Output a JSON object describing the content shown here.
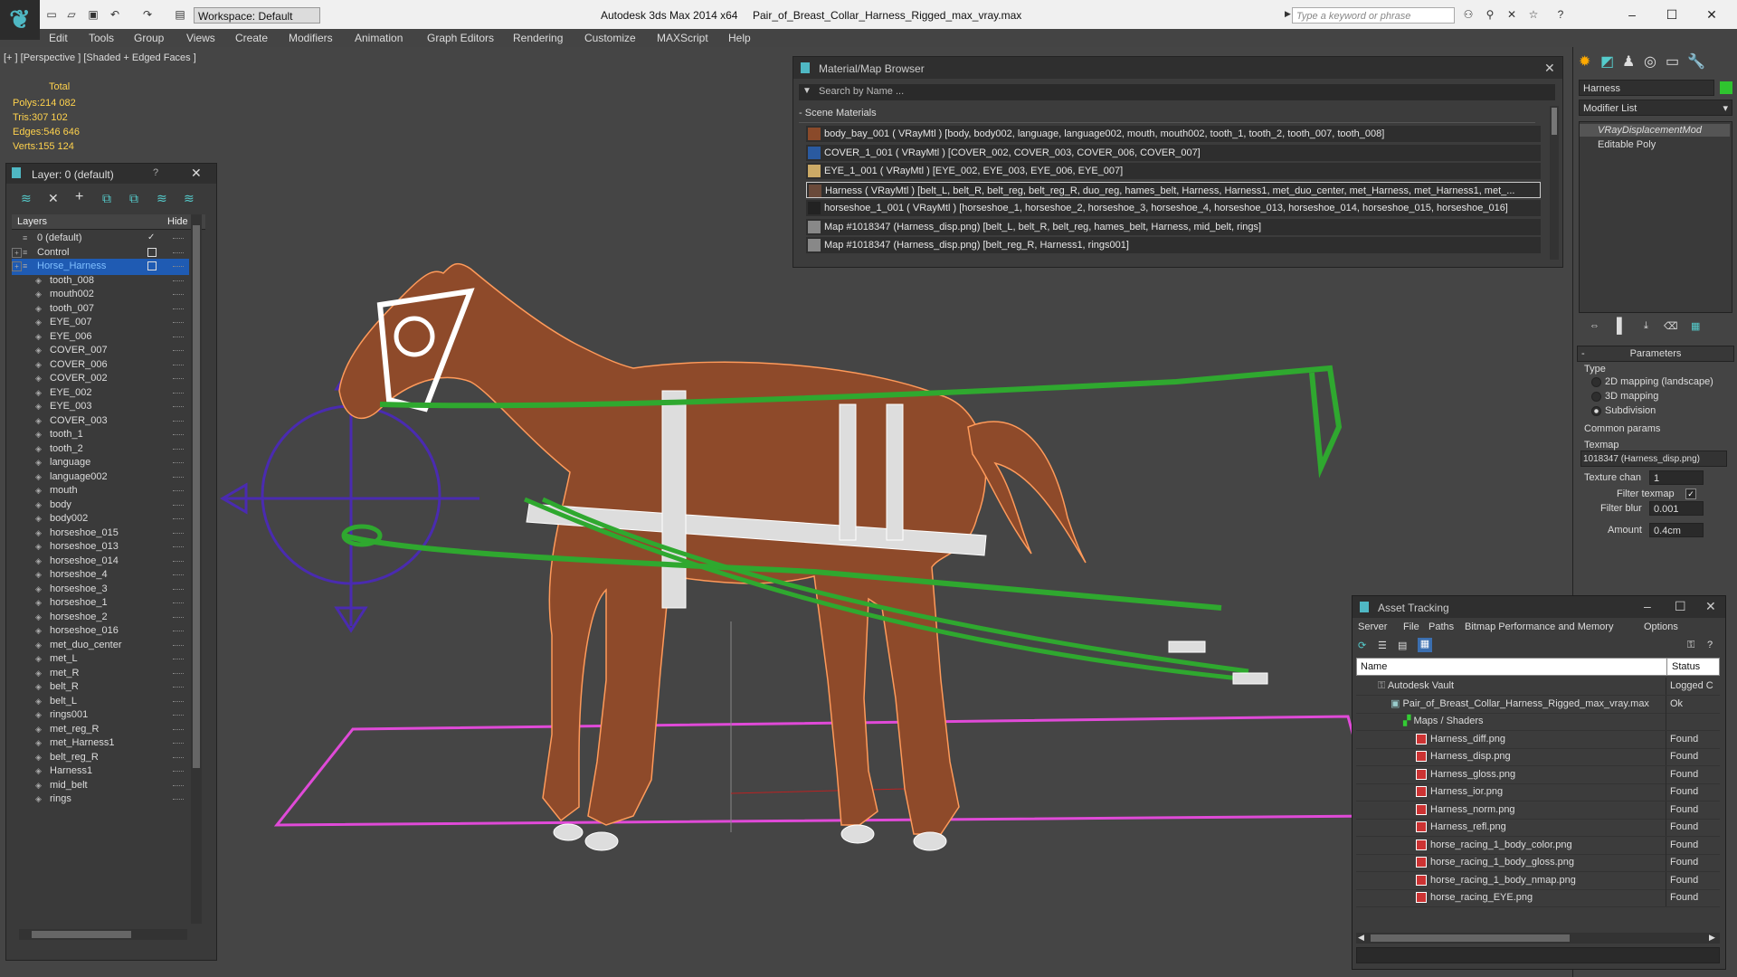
{
  "titlebar": {
    "workspace": "Workspace: Default",
    "app_name": "Autodesk 3ds Max  2014 x64",
    "file_name": "Pair_of_Breast_Collar_Harness_Rigged_max_vray.max",
    "search_placeholder": "Type a keyword or phrase"
  },
  "menu": [
    "Edit",
    "Tools",
    "Group",
    "Views",
    "Create",
    "Modifiers",
    "Animation",
    "Graph Editors",
    "Rendering",
    "Customize",
    "MAXScript",
    "Help"
  ],
  "viewport": {
    "label": "[+ ] [Perspective ] [Shaded + Edged Faces ]",
    "stats_title": "Total",
    "stats": [
      {
        "key": "Polys:",
        "value": "214 082"
      },
      {
        "key": "Tris:",
        "value": "307 102"
      },
      {
        "key": "Edges:",
        "value": "546 646"
      },
      {
        "key": "Verts:",
        "value": "155 124"
      }
    ]
  },
  "layer_panel": {
    "title": "Layer: 0 (default)",
    "help": "?",
    "col_layers": "Layers",
    "col_hide": "Hide",
    "layers": [
      "0 (default)",
      "Control",
      "Horse_Harness"
    ],
    "objects": [
      "tooth_008",
      "mouth002",
      "tooth_007",
      "EYE_007",
      "EYE_006",
      "COVER_007",
      "COVER_006",
      "COVER_002",
      "EYE_002",
      "EYE_003",
      "COVER_003",
      "tooth_1",
      "tooth_2",
      "language",
      "language002",
      "mouth",
      "body",
      "body002",
      "horseshoe_015",
      "horseshoe_013",
      "horseshoe_014",
      "horseshoe_4",
      "horseshoe_3",
      "horseshoe_1",
      "horseshoe_2",
      "horseshoe_016",
      "met_duo_center",
      "met_L",
      "met_R",
      "belt_R",
      "belt_L",
      "rings001",
      "met_reg_R",
      "met_Harness1",
      "belt_reg_R",
      "Harness1",
      "mid_belt",
      "rings"
    ]
  },
  "material_browser": {
    "title": "Material/Map Browser",
    "search_placeholder": "Search by Name ...",
    "group": "Scene Materials",
    "rows": [
      "body_bay_001  ( VRayMtl )  [body, body002, language, language002, mouth, mouth002, tooth_1, tooth_2, tooth_007, tooth_008]",
      "COVER_1_001  ( VRayMtl )  [COVER_002, COVER_003, COVER_006, COVER_007]",
      "EYE_1_001  ( VRayMtl )  [EYE_002, EYE_003, EYE_006, EYE_007]",
      "Harness  ( VRayMtl )  [belt_L, belt_R, belt_reg, belt_reg_R, duo_reg, hames_belt, Harness, Harness1, met_duo_center, met_Harness, met_Harness1, met_...",
      "horseshoe_1_001  ( VRayMtl )  [horseshoe_1, horseshoe_2, horseshoe_3, horseshoe_4, horseshoe_013, horseshoe_014, horseshoe_015, horseshoe_016]",
      "Map #1018347 (Harness_disp.png)  [belt_L, belt_R, belt_reg, hames_belt, Harness, mid_belt, rings]",
      "Map #1018347 (Harness_disp.png)  [belt_reg_R, Harness1, rings001]"
    ]
  },
  "command_panel": {
    "object_name": "Harness",
    "modifier_list": "Modifier List",
    "stack": [
      "VRayDisplacementMod",
      "Editable Poly"
    ],
    "parameters_title": "Parameters",
    "type_label": "Type",
    "type_options": [
      "2D mapping (landscape)",
      "3D mapping",
      "Subdivision"
    ],
    "common_params": "Common params",
    "texmap_label": "Texmap",
    "texmap_value": "1018347 (Harness_disp.png)",
    "texture_chan_label": "Texture chan",
    "texture_chan_value": "1",
    "filter_texmap_label": "Filter texmap",
    "filter_blur_label": "Filter blur",
    "filter_blur_value": "0.001",
    "amount_label": "Amount",
    "amount_value": "0.4cm"
  },
  "asset_tracking": {
    "title": "Asset Tracking",
    "menu": [
      "Server",
      "File",
      "Paths",
      "Bitmap Performance and Memory",
      "Options"
    ],
    "col_name": "Name",
    "col_status": "Status",
    "rows": [
      {
        "name": "Autodesk Vault",
        "status": "Logged C"
      },
      {
        "name": "Pair_of_Breast_Collar_Harness_Rigged_max_vray.max",
        "status": "Ok"
      },
      {
        "name": "Maps / Shaders",
        "status": ""
      },
      {
        "name": "Harness_diff.png",
        "status": "Found"
      },
      {
        "name": "Harness_disp.png",
        "status": "Found"
      },
      {
        "name": "Harness_gloss.png",
        "status": "Found"
      },
      {
        "name": "Harness_ior.png",
        "status": "Found"
      },
      {
        "name": "Harness_norm.png",
        "status": "Found"
      },
      {
        "name": "Harness_refl.png",
        "status": "Found"
      },
      {
        "name": "horse_racing_1_body_color.png",
        "status": "Found"
      },
      {
        "name": "horse_racing_1_body_gloss.png",
        "status": "Found"
      },
      {
        "name": "horse_racing_1_body_nmap.png",
        "status": "Found"
      },
      {
        "name": "horse_racing_EYE.png",
        "status": "Found"
      }
    ]
  }
}
